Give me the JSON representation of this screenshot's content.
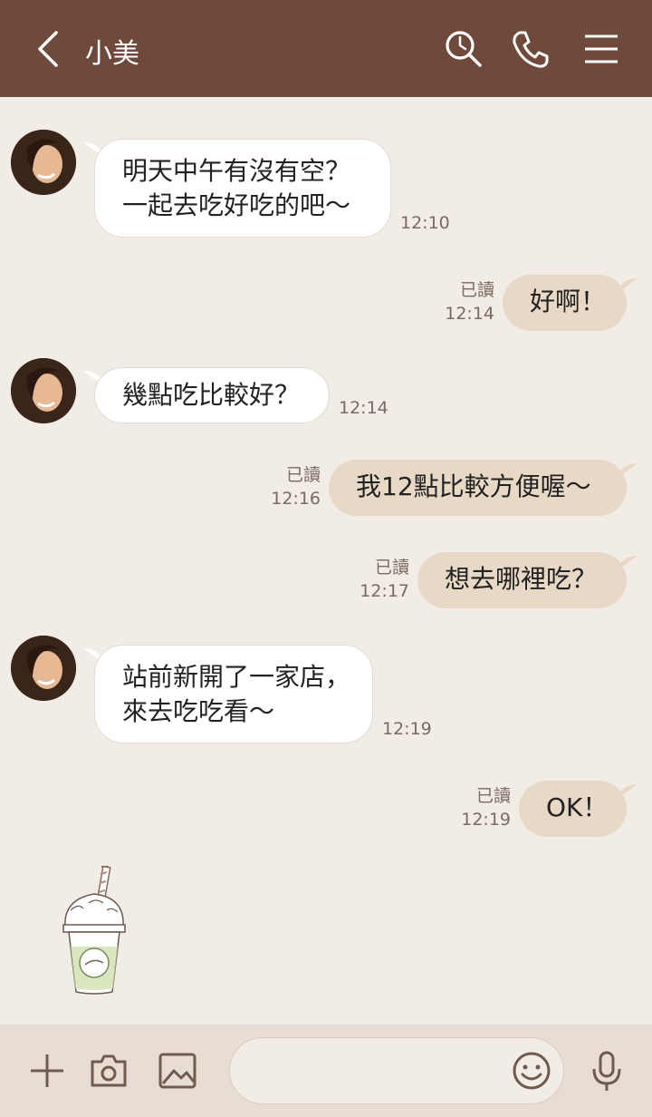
{
  "header": {
    "title": "小美",
    "back_icon": "chevron-left-icon",
    "search_icon": "search-icon",
    "call_icon": "phone-icon",
    "menu_icon": "hamburger-menu-icon",
    "background": "#6f4a3c"
  },
  "messages": [
    {
      "direction": "in",
      "text": "明天中午有沒有空？\n一起去吃好吃的吧～",
      "time": "12:10"
    },
    {
      "direction": "out",
      "text": "好啊！",
      "read": "已讀",
      "time": "12:14"
    },
    {
      "direction": "in",
      "text": "幾點吃比較好？",
      "time": "12:14"
    },
    {
      "direction": "out",
      "text": "我12點比較方便喔～",
      "read": "已讀",
      "time": "12:16"
    },
    {
      "direction": "out",
      "text": "想去哪裡吃？",
      "read": "已讀",
      "time": "12:17"
    },
    {
      "direction": "in",
      "text": "站前新開了一家店，\n來去吃吃看～",
      "time": "12:19"
    },
    {
      "direction": "out",
      "text": "OK！",
      "read": "已讀",
      "time": "12:19"
    }
  ],
  "sticker": {
    "name": "matcha-frappe-sticker"
  },
  "input_bar": {
    "add_icon": "plus-icon",
    "camera_icon": "camera-icon",
    "image_icon": "image-icon",
    "placeholder": "",
    "emoji_icon": "emoji-icon",
    "mic_icon": "microphone-icon"
  },
  "colors": {
    "chat_background": "#f2ece7",
    "outgoing_bubble": "#e8d8c6",
    "incoming_bubble": "#ffffff",
    "input_bar": "#e8ddd4"
  }
}
